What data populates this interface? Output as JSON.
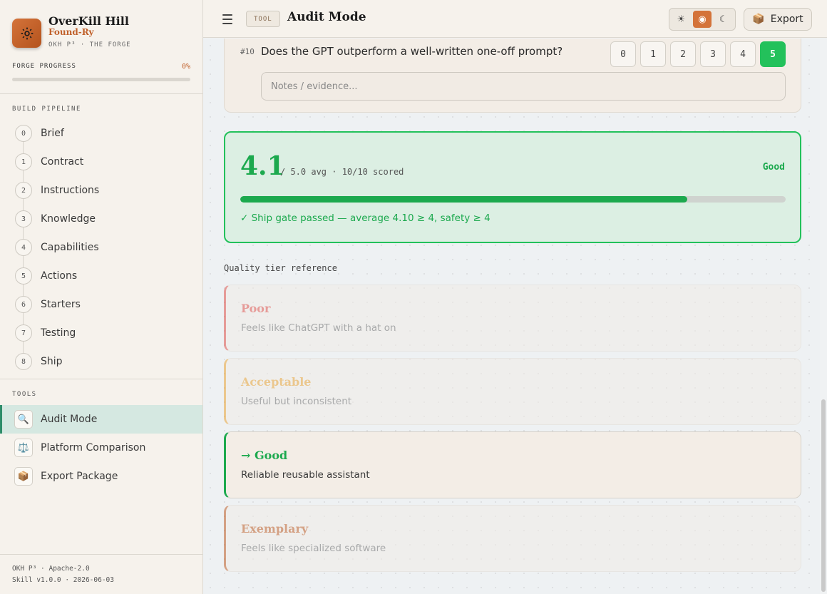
{
  "brand": {
    "title": "OverKill Hill",
    "subtitle": "Found-Ry",
    "tagline": "OKH P³ · THE FORGE"
  },
  "progress": {
    "label": "FORGE PROGRESS",
    "value": 0,
    "display": "0%"
  },
  "pipeline": {
    "heading": "BUILD PIPELINE",
    "items": [
      {
        "num": "0",
        "label": "Brief"
      },
      {
        "num": "1",
        "label": "Contract"
      },
      {
        "num": "2",
        "label": "Instructions"
      },
      {
        "num": "3",
        "label": "Knowledge"
      },
      {
        "num": "4",
        "label": "Capabilities"
      },
      {
        "num": "5",
        "label": "Actions"
      },
      {
        "num": "6",
        "label": "Starters"
      },
      {
        "num": "7",
        "label": "Testing"
      },
      {
        "num": "8",
        "label": "Ship"
      }
    ]
  },
  "tools": {
    "heading": "TOOLS",
    "items": [
      {
        "icon": "🔍",
        "icon_name": "magnifier-icon",
        "label": "Audit Mode",
        "active": true
      },
      {
        "icon": "⚖️",
        "icon_name": "scales-icon",
        "label": "Platform Comparison",
        "active": false
      },
      {
        "icon": "📦",
        "icon_name": "package-icon",
        "label": "Export Package",
        "active": false
      }
    ]
  },
  "footer": {
    "line1": "OKH P³ · Apache-2.0",
    "line2": "Skill v1.0.0 · 2026-06-03"
  },
  "header": {
    "badge": "TOOL",
    "title": "Audit Mode",
    "theme": {
      "light_icon": "☀",
      "auto_icon": "◉",
      "dark_icon": "☾",
      "active": "auto"
    },
    "export_icon": "📦",
    "export_label": "Export"
  },
  "question": {
    "number": "#10",
    "text": "Does the GPT outperform a well-written one-off prompt?",
    "scores": [
      "0",
      "1",
      "2",
      "3",
      "4",
      "5"
    ],
    "selected": "5",
    "notes_value": "",
    "notes_placeholder": "Notes / evidence..."
  },
  "summary": {
    "score": "4.1",
    "meta": "/ 5.0 avg · 10/10 scored",
    "tier": "Good",
    "fraction": 0.82,
    "gate_message": "✓ Ship gate passed — average 4.10 ≥ 4, safety ≥ 4"
  },
  "tier_reference": {
    "heading": "Quality tier reference",
    "tiers": [
      {
        "name": "Poor",
        "desc": "Feels like ChatGPT with a hat on",
        "color": "#e0564f",
        "active": false
      },
      {
        "name": "Acceptable",
        "desc": "Useful but inconsistent",
        "color": "#e9a53a",
        "active": false
      },
      {
        "name": "→ Good",
        "desc": "Reliable reusable assistant",
        "color": "#1ca94e",
        "active": true
      },
      {
        "name": "Exemplary",
        "desc": "Feels like specialized software",
        "color": "#c0602a",
        "active": false
      }
    ]
  },
  "colors": {
    "accent": "#c0602a",
    "success": "#1ca94e"
  }
}
